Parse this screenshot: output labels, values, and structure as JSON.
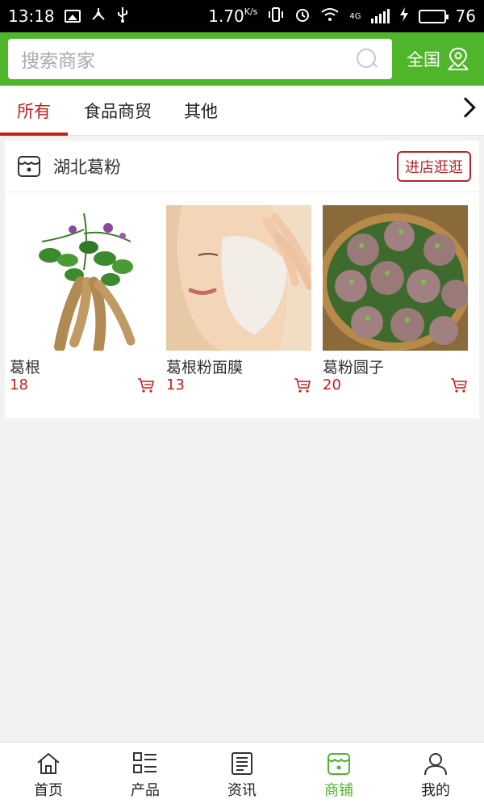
{
  "status_bar": {
    "time": "13:18",
    "network_speed": "1.70",
    "network_unit": "K/s",
    "network_type": "4G",
    "battery_level": "76",
    "battery_fraction": 0.76,
    "icons": [
      "image-icon",
      "share-icon",
      "usb-icon",
      "vibrate-icon",
      "alarm-icon",
      "wifi-icon",
      "signal-icon",
      "charging-icon",
      "battery-icon"
    ]
  },
  "header": {
    "search_placeholder": "搜索商家",
    "region_label": "全国",
    "accent_color": "#4fb52a"
  },
  "tabs": [
    {
      "label": "所有",
      "active": true
    },
    {
      "label": "食品商贸",
      "active": false
    },
    {
      "label": "其他",
      "active": false
    }
  ],
  "shop": {
    "name": "湖北葛粉",
    "visit_label": "进店逛逛",
    "products": [
      {
        "name": "葛根",
        "price": "18"
      },
      {
        "name": "葛根粉面膜",
        "price": "13"
      },
      {
        "name": "葛粉圆子",
        "price": "20"
      }
    ]
  },
  "bottom_nav": [
    {
      "label": "首页",
      "icon": "home-icon",
      "active": false
    },
    {
      "label": "产品",
      "icon": "products-icon",
      "active": false
    },
    {
      "label": "资讯",
      "icon": "news-icon",
      "active": false
    },
    {
      "label": "商铺",
      "icon": "store-icon",
      "active": true
    },
    {
      "label": "我的",
      "icon": "profile-icon",
      "active": false
    }
  ],
  "colors": {
    "price_red": "#c71d1d",
    "active_tab_red": "#c71d1d",
    "visit_button_red": "#b5262b"
  }
}
